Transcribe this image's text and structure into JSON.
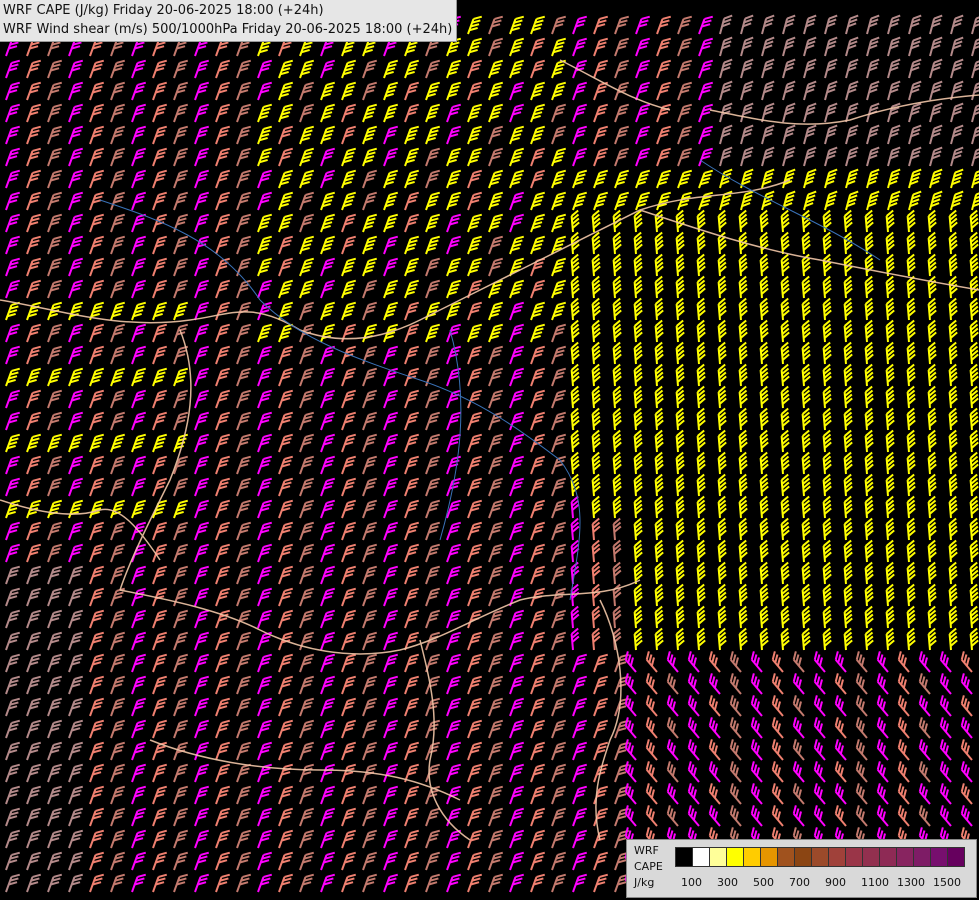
{
  "header": {
    "line1": "WRF CAPE (J/kg) Friday 20-06-2025 18:00 (+24h)",
    "line2": "WRF Wind shear (m/s) 500/1000hPa Friday 20-06-2025 18:00 (+24h)"
  },
  "legend": {
    "line1": "WRF",
    "line2": "CAPE",
    "line3": "J/kg",
    "colors": [
      "#000000",
      "#ffffff",
      "#ffff99",
      "#ffff00",
      "#ffcc00",
      "#e69500",
      "#a0521e",
      "#8b4513",
      "#9b4a2a",
      "#a0413a",
      "#9a3548",
      "#92304f",
      "#8e2a55",
      "#882460",
      "#7e1c66",
      "#770f6e",
      "#66005e"
    ],
    "ticks": [
      "100",
      "300",
      "500",
      "700",
      "900",
      "1100",
      "1300",
      "1500"
    ]
  },
  "map": {
    "barb_colors": {
      "weak": "#ff00ff",
      "moderate": "#f08070",
      "strong": "#ffff00",
      "very_strong": "#c47a6e",
      "grey": "#b48a8a"
    }
  }
}
